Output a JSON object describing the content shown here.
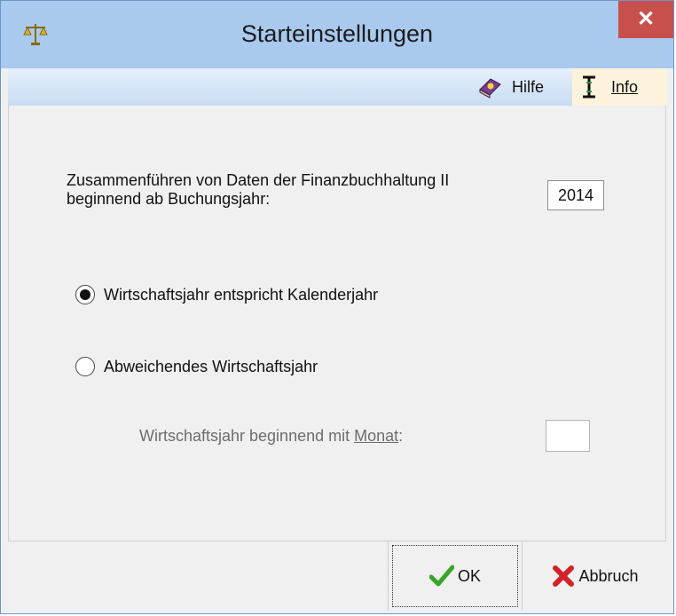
{
  "window": {
    "title": "Starteinstellungen",
    "close_symbol": "✕"
  },
  "toolbar": {
    "hilfe": {
      "label": "Hilfe",
      "icon": "help-book-icon"
    },
    "info": {
      "label": "Info",
      "icon": "info-cursor-icon"
    }
  },
  "form": {
    "merge_label_line1": "Zusammenführen von Daten der Finanzbuchhaltung II",
    "merge_label_line2": "beginnend ab Buchungsjahr:",
    "year_value": "2014",
    "radio_calendar": "Wirtschaftsjahr entspricht Kalenderjahr",
    "radio_deviating": "Abweichendes Wirtschaftsjahr",
    "selected_option": "calendar",
    "month_label_prefix": "Wirtschaftsjahr beginnend mit ",
    "month_label_key": "Monat",
    "month_label_suffix": ":",
    "month_value": ""
  },
  "footer": {
    "ok_label": "OK",
    "cancel_label": "Abbruch"
  },
  "colors": {
    "titlebar": "#a9c9ee",
    "close": "#c7504c",
    "info_highlight": "#fdf3dc"
  }
}
